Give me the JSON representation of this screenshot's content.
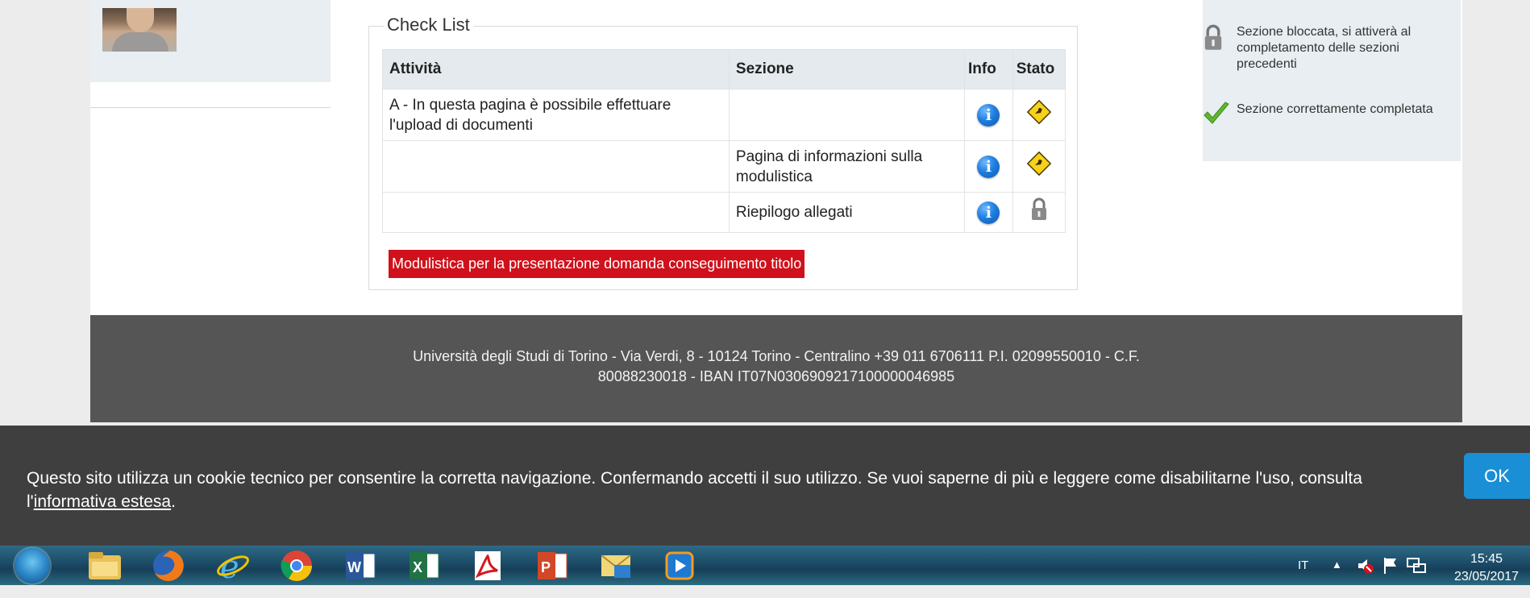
{
  "checklist": {
    "title": "Check List",
    "headers": {
      "activity": "Attività",
      "section": "Sezione",
      "info": "Info",
      "status": "Stato"
    },
    "rows": [
      {
        "activity": "A - In questa pagina è possibile effettuare l'upload di documenti",
        "section": "",
        "info_icon": "info-icon",
        "status_icon": "warning-sign-icon"
      },
      {
        "activity": "",
        "section": "Pagina di informazioni sulla modulistica",
        "info_icon": "info-icon",
        "status_icon": "warning-sign-icon"
      },
      {
        "activity": "",
        "section": "Riepilogo allegati",
        "info_icon": "info-icon",
        "status_icon": "lock-icon"
      }
    ],
    "action_button": "Modulistica per la presentazione domanda conseguimento titolo"
  },
  "legend": {
    "locked": "Sezione bloccata, si attiverà al completamento delle sezioni precedenti",
    "done": "Sezione correttamente completata"
  },
  "footer": {
    "line1": "Università degli Studi di Torino - Via Verdi, 8 - 10124 Torino - Centralino +39 011 6706111 P.I. 02099550010 - C.F.",
    "line2": "80088230018 - IBAN IT07N0306909217100000046985"
  },
  "cookie_banner": {
    "text_before": "Questo sito utilizza un cookie tecnico per consentire la corretta navigazione. Confermando accetti il suo utilizzo. Se vuoi saperne di più e leggere come disabilitarne l'uso, consulta l'",
    "link": "informativa estesa",
    "text_after": ".",
    "ok_button": "OK"
  },
  "taskbar": {
    "apps": [
      "start-orb-icon",
      "file-explorer-icon",
      "firefox-icon",
      "internet-explorer-icon",
      "chrome-icon",
      "word-icon",
      "excel-icon",
      "acrobat-icon",
      "powerpoint-icon",
      "outlook-icon",
      "media-player-icon"
    ],
    "language": "IT",
    "time": "15:45",
    "date": "23/05/2017"
  },
  "colors": {
    "accent_red": "#d0111b",
    "ok_blue": "#1a8fd6",
    "footer_gray": "#555555",
    "cookie_bg": "#3f3f3f"
  }
}
